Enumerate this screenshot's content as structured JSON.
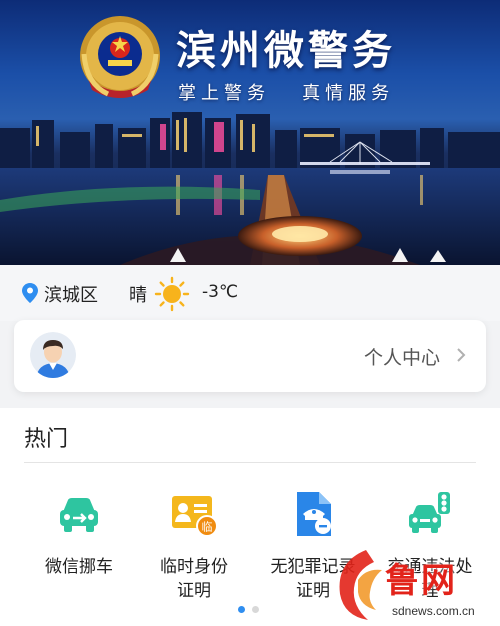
{
  "banner": {
    "title": "滨州微警务",
    "slogan": "掌上警务   真情服务"
  },
  "location": {
    "district": "滨城区",
    "icon": "location-pin-icon"
  },
  "weather": {
    "condition": "晴",
    "icon": "sun-icon",
    "temperature": "-3℃"
  },
  "user_card": {
    "label": "个人中心",
    "avatar_icon": "user-avatar-icon",
    "chevron_icon": "chevron-right-icon"
  },
  "hot": {
    "title": "热门",
    "services": [
      {
        "label": "微信挪车",
        "icon": "car-move-icon"
      },
      {
        "label": "临时身份证明",
        "icon": "temp-id-card-icon"
      },
      {
        "label": "无犯罪记录证明",
        "icon": "no-crime-record-icon"
      },
      {
        "label": "交通违法处理",
        "icon": "traffic-violation-icon"
      }
    ]
  },
  "pager": {
    "pages": 2,
    "active": 1
  },
  "watermark": {
    "text": "鲁网",
    "url": "sdnews.com.cn"
  },
  "colors": {
    "accent_blue": "#2f8ef0",
    "service_green": "#2ec5a0",
    "service_yellow": "#f4b71c",
    "service_blue": "#2a86e8",
    "watermark_red": "#e2231a"
  }
}
